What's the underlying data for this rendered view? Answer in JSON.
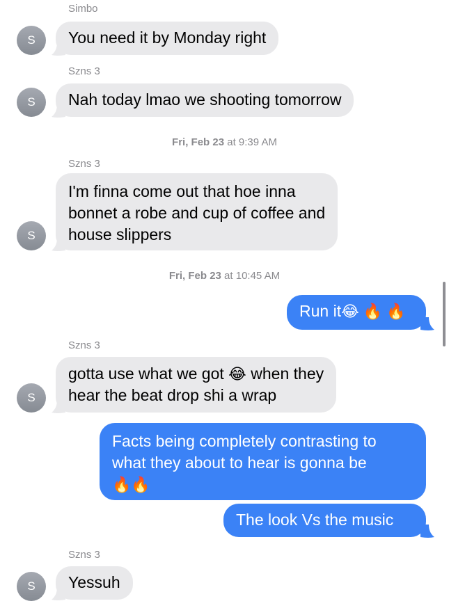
{
  "thread": {
    "messages": [
      {
        "sender": "Simbo",
        "avatar": "S",
        "text": "You need it by Monday right"
      },
      {
        "sender": "Szns 3",
        "avatar": "S",
        "text": "Nah today lmao we shooting tomorrow"
      },
      {
        "timestamp_day": "Fri, Feb 23",
        "timestamp_time": " at 9:39 AM"
      },
      {
        "sender": "Szns 3",
        "avatar": "S",
        "lines": [
          "I'm finna come out that hoe inna",
          "bonnet a robe and cup of coffee and",
          "house slippers"
        ]
      },
      {
        "timestamp_day": "Fri, Feb 23",
        "timestamp_time": " at 10:45 AM"
      },
      {
        "outgoing": true,
        "text": "Run it",
        "emoji": "😂 🔥 🔥"
      },
      {
        "sender": "Szns 3",
        "avatar": "S",
        "line1_a": "gotta use what we got ",
        "line1_emoji": "😂",
        "line1_b": " when they",
        "line2": "hear the beat drop shi a wrap"
      },
      {
        "outgoing": true,
        "lines": [
          "Facts being completely contrasting to",
          "what they about to hear is gonna be"
        ],
        "emoji": "🔥🔥"
      },
      {
        "outgoing": true,
        "text": "The look Vs the music"
      },
      {
        "sender": "Szns 3",
        "avatar": "S",
        "text": "Yessuh"
      }
    ]
  },
  "colors": {
    "incoming_bubble": "#e9e9eb",
    "outgoing_bubble": "#3b82f6",
    "meta_text": "#8a8a8e"
  }
}
